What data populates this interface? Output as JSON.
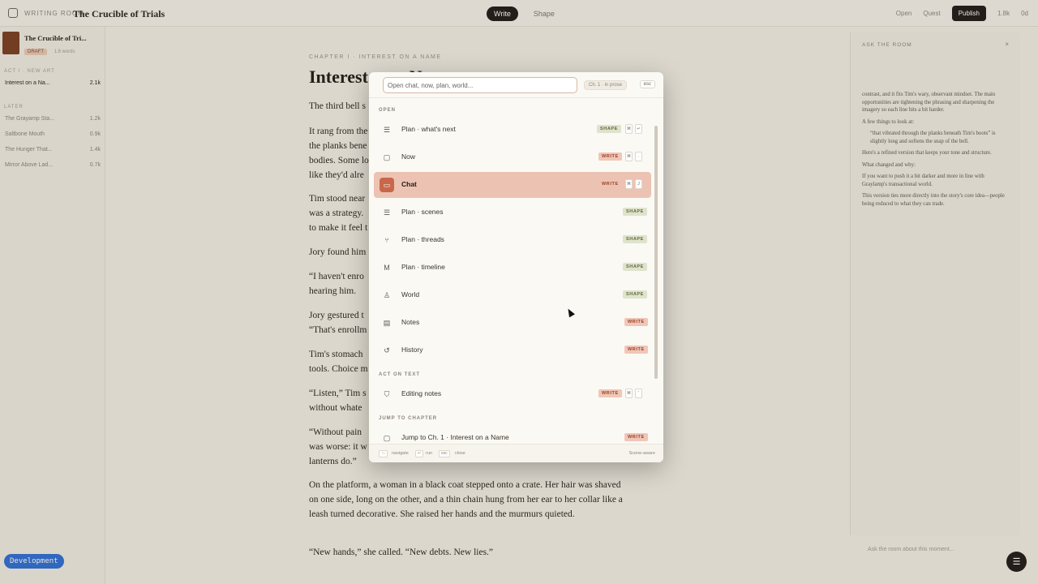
{
  "topbar": {
    "breadcrumb": "Writing room",
    "title": "The Crucible of Trials",
    "modes": [
      "Write",
      "Shape"
    ],
    "active_mode": "Write",
    "right": {
      "open": "Open",
      "quest": "Quest",
      "publish": "Publish",
      "words": "1.8k",
      "stat": "0d"
    }
  },
  "sidebar": {
    "book_title": "The Crucible of Tri...",
    "book_tag": "DRAFT",
    "book_meta": "1.8 words",
    "section_label_act": "Act I · New Art",
    "active_chapter": {
      "label": "Interest on a Na...",
      "count": "2.1k"
    },
    "section_label_later": "Later",
    "chapters": [
      {
        "label": "The Grayamp Sta...",
        "count": "1.2k"
      },
      {
        "label": "Saltbone Mouth",
        "count": "0.9k"
      },
      {
        "label": "The Hunger That...",
        "count": "1.4k"
      },
      {
        "label": "Mirror Above Lad...",
        "count": "0.7k"
      }
    ],
    "dev_badge": "Development"
  },
  "editor": {
    "chapter_label": "Chapter I · Interest on a Name",
    "chapter_title": "Interest on a Name",
    "paragraphs": [
      "The third bell s",
      "It rang from the\nthe planks bene\nbodies. Some lo\nlike they'd alre",
      "Tim stood near\nwas a strategy.\nto make it feel t",
      "Jory found him",
      "“I haven't enro\nhearing him.",
      "Jory gestured t\n“That's enrollm",
      "Tim's stomach\ntools. Choice m",
      "“Listen,” Tim s\nwithout whate",
      "“Without pain\nwas worse: it w\nlanterns do.”",
      "On the platform, a woman in a black coat stepped onto a crate. Her hair was shaved on one side, long on the other, and a thin chain hung from her ear to her collar like a leash turned decorative. She raised her hands and the murmurs quieted.",
      "“New hands,” she called. “New debts. New lies.”"
    ]
  },
  "right_panel": {
    "heading": "Ask the room",
    "paragraphs": [
      "contrast, and it fits Tim's wary, observant mindset. The main opportunities are tightening the phrasing and sharpening the imagery so each line hits a bit harder.",
      "A few things to look at:",
      "“that vibrated through the planks beneath Tim's boots” is slightly long and softens the snap of the bell.",
      "Here's a refined version that keeps your tone and structure.",
      "What changed and why:",
      "If you want to push it a bit darker and more in line with Graylamp's transactional world.",
      "This version ties more directly into the story's core idea—people being reduced to what they can trade."
    ],
    "input_placeholder": "Ask the room about this moment..."
  },
  "palette": {
    "search_placeholder": "Open chat, now, plan, world...",
    "scope": "Ch. 1 · in prose",
    "esc": "esc",
    "sections": {
      "open": "Open",
      "act_on_text": "Act on text",
      "jump": "Jump to chapter"
    },
    "items": [
      {
        "label": "Plan · what's next",
        "badge": "SHAPE",
        "icon": "list-icon",
        "keys": [
          "⌘",
          "↵"
        ]
      },
      {
        "label": "Now",
        "badge": "WRITE",
        "icon": "square-icon",
        "keys": [
          "⌘",
          "."
        ]
      },
      {
        "label": "Chat",
        "badge": "WRITE",
        "icon": "chat-icon",
        "keys": [
          "⌘",
          "J"
        ],
        "selected": true
      },
      {
        "label": "Plan · scenes",
        "badge": "SHAPE",
        "icon": "list-icon"
      },
      {
        "label": "Plan · threads",
        "badge": "SHAPE",
        "icon": "threads-icon"
      },
      {
        "label": "Plan · timeline",
        "badge": "SHAPE",
        "icon": "timeline-icon"
      },
      {
        "label": "World",
        "badge": "SHAPE",
        "icon": "person-icon"
      },
      {
        "label": "Notes",
        "badge": "WRITE",
        "icon": "note-icon"
      },
      {
        "label": "History",
        "badge": "WRITE",
        "icon": "history-icon"
      },
      {
        "label": "Editing notes",
        "badge": "WRITE",
        "icon": "shield-icon",
        "keys": [
          "⌘",
          "'"
        ]
      },
      {
        "label": "Jump to Ch. 1 · Interest on a Name",
        "badge": "WRITE",
        "icon": "square-icon"
      }
    ],
    "footer": {
      "nav_key": "↑↓",
      "nav": "navigate",
      "run_key": "↵",
      "run": "run",
      "close_key": "esc",
      "close": "close",
      "right": "Scene-aware"
    }
  },
  "colors": {
    "accent": "#c9674a",
    "selected_bg": "#ecc3b3",
    "shape_bg": "#dfe3cc",
    "write_bg": "#f0c6b8",
    "dev_blue": "#2f6fd6"
  }
}
